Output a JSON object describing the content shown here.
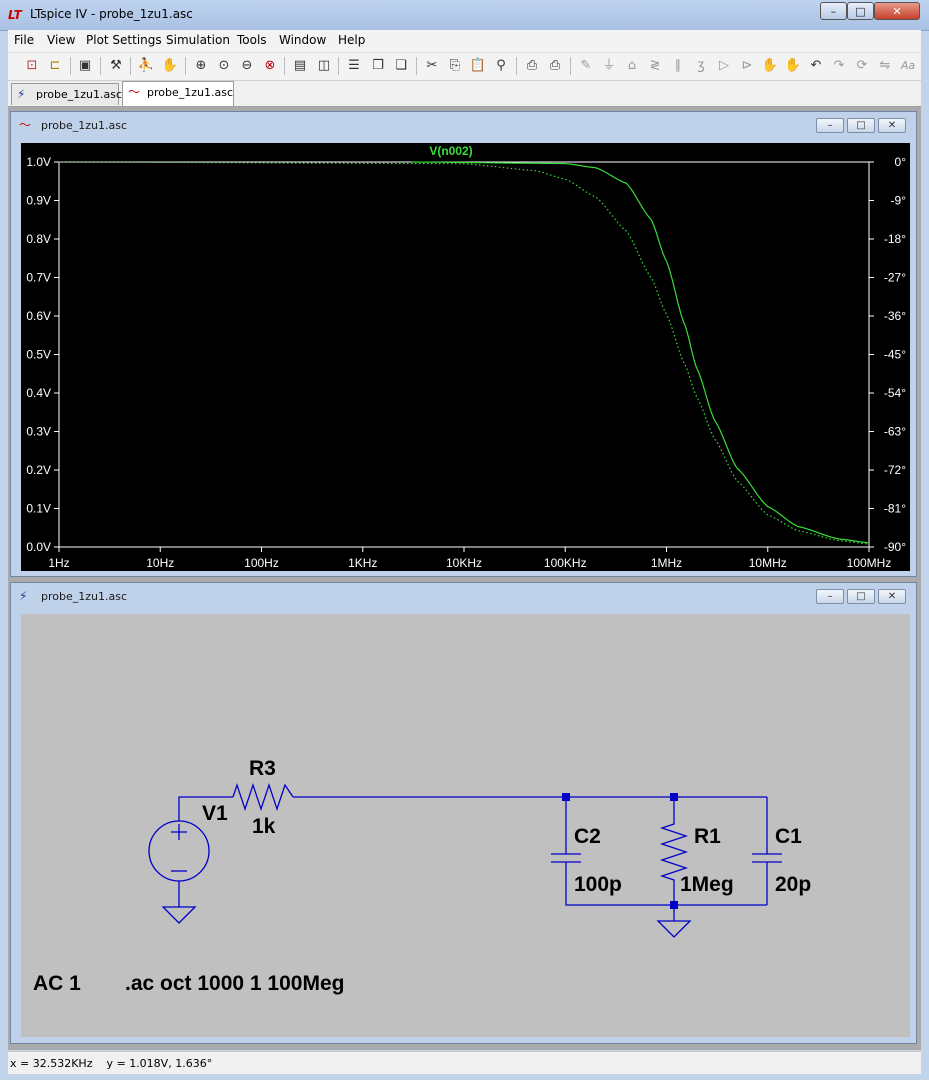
{
  "window": {
    "title": "LTspice IV - probe_1zu1.asc"
  },
  "caption_buttons": {
    "minimize": "–",
    "maximize": "□",
    "close": "✕"
  },
  "menu": [
    "File",
    "View",
    "Plot Settings",
    "Simulation",
    "Tools",
    "Window",
    "Help"
  ],
  "toolbar_icons": [
    "new-schematic-icon",
    "open-icon",
    "save-icon",
    "control-panel-icon",
    "run-icon",
    "halt-icon",
    "zoom-in-icon",
    "zoom-area-icon",
    "zoom-out-icon",
    "zoom-cancel-icon",
    "autorange-icon",
    "manual-limits-icon",
    "tile-horizontal-icon",
    "cascade-icon",
    "close-all-icon",
    "cut-icon",
    "copy-icon",
    "paste-icon",
    "find-icon",
    "print-setup-icon",
    "print-icon",
    "draw-wire-icon",
    "ground-icon",
    "label-net-icon",
    "resistor-icon",
    "capacitor-icon",
    "inductor-icon",
    "diode-icon",
    "component-icon",
    "move-icon",
    "drag-icon",
    "undo-icon",
    "redo-icon",
    "rotate-icon",
    "mirror-icon",
    "text-icon"
  ],
  "tabs": [
    {
      "label": "probe_1zu1.asc",
      "icon": "schematic-icon",
      "active": false
    },
    {
      "label": "probe_1zu1.asc",
      "icon": "waveform-icon",
      "active": true
    }
  ],
  "plot_window": {
    "title": "probe_1zu1.asc"
  },
  "schematic_window": {
    "title": "probe_1zu1.asc"
  },
  "colors": {
    "trace": "#3adc3a",
    "wire": "#0000c8",
    "plot_bg": "#000000",
    "schem_bg": "#c0c0c0"
  },
  "chart_data": {
    "type": "line",
    "title": "V(n002)",
    "x_scale": "log",
    "xlim": [
      1,
      100000000
    ],
    "xticks": [
      "1Hz",
      "10Hz",
      "100Hz",
      "1KHz",
      "10KHz",
      "100KHz",
      "1MHz",
      "10MHz",
      "100MHz"
    ],
    "ylim": [
      0,
      1.0
    ],
    "yticks": [
      "0.0V",
      "0.1V",
      "0.2V",
      "0.3V",
      "0.4V",
      "0.5V",
      "0.6V",
      "0.7V",
      "0.8V",
      "0.9V",
      "1.0V"
    ],
    "y2lim": [
      -90,
      0
    ],
    "y2ticks": [
      "-90°",
      "-81°",
      "-72°",
      "-63°",
      "-54°",
      "-45°",
      "-36°",
      "-27°",
      "-18°",
      "-9°",
      "0°"
    ],
    "series": [
      {
        "name": "V(n002)",
        "style": "solid",
        "axis": "magnitude",
        "x_start": 3000,
        "x": [
          3000,
          100000,
          200000,
          400000,
          700000,
          1000000,
          1500000,
          2000000,
          3000000,
          5000000,
          10000000,
          20000000,
          50000000,
          100000000
        ],
        "y": [
          1.0,
          0.996,
          0.985,
          0.945,
          0.852,
          0.742,
          0.58,
          0.463,
          0.328,
          0.204,
          0.105,
          0.053,
          0.021,
          0.011
        ]
      },
      {
        "name": "V(n002) phase",
        "style": "dotted",
        "axis": "phase",
        "x": [
          1,
          10000,
          50000,
          100000,
          200000,
          400000,
          700000,
          1000000,
          1500000,
          2000000,
          3000000,
          5000000,
          10000000,
          20000000,
          50000000,
          100000000
        ],
        "y": [
          0,
          -0.4,
          -2.0,
          -4.0,
          -8.2,
          -16.1,
          -26.9,
          -35.6,
          -47.1,
          -55.0,
          -64.8,
          -74.6,
          -82.5,
          -86.2,
          -88.5,
          -89.3
        ]
      }
    ]
  },
  "schematic": {
    "labels": {
      "r3_name": "R3",
      "r3_value": "1k",
      "v1_name": "V1",
      "c2_name": "C2",
      "c2_value": "100p",
      "r1_name": "R1",
      "r1_value": "1Meg",
      "c1_name": "C1",
      "c1_value": "20p",
      "source_spec": "AC 1",
      "directive": ".ac oct 1000 1 100Meg"
    }
  },
  "status": {
    "x_readout": "x = 32.532KHz",
    "y_readout": "y = 1.018V, 1.636°"
  }
}
